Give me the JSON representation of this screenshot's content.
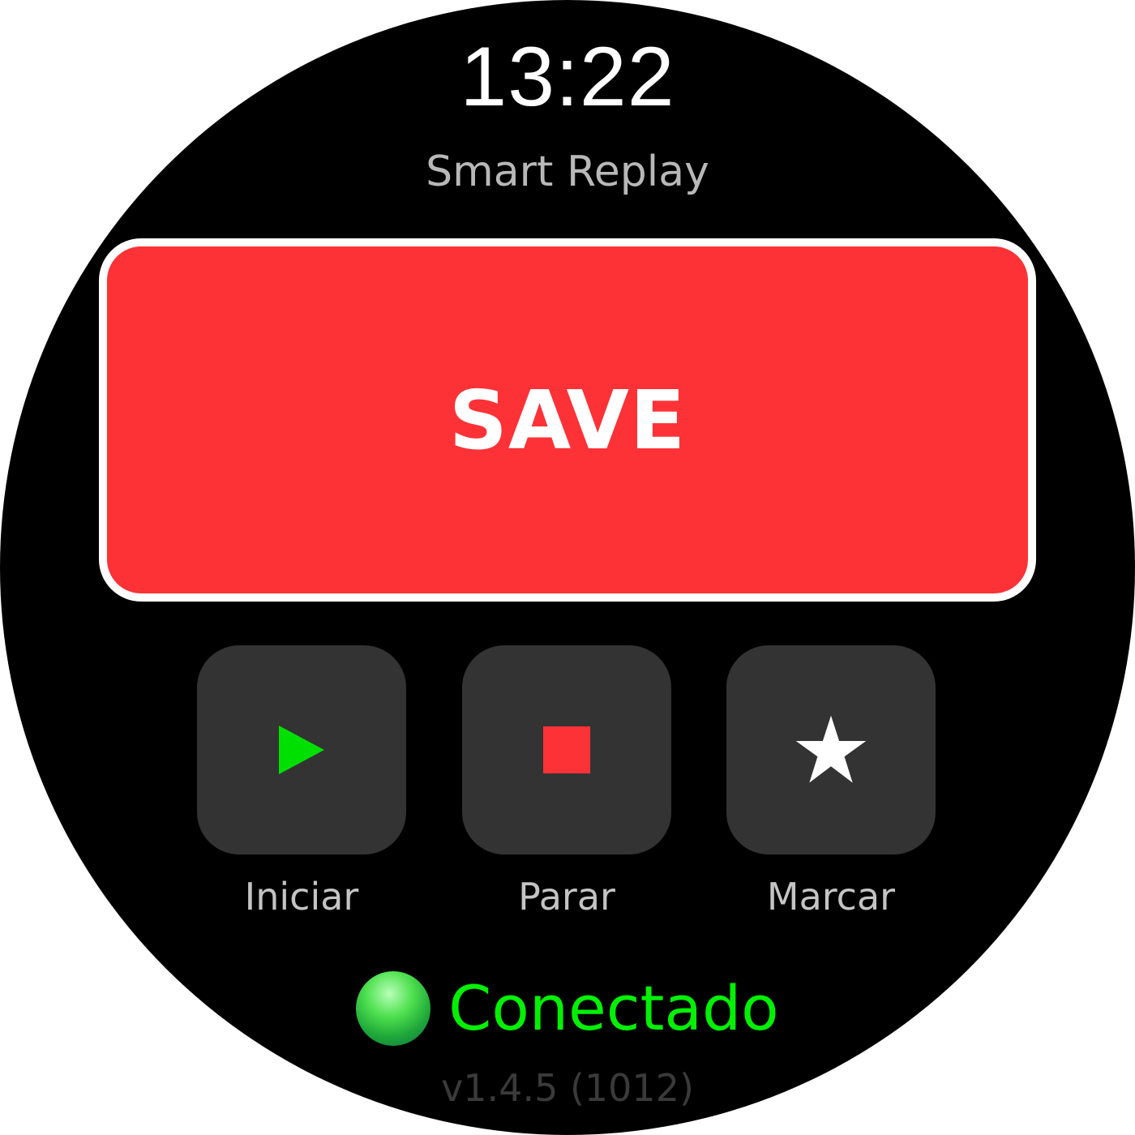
{
  "header": {
    "time": "13:22",
    "app_title": "Smart Replay"
  },
  "save_button": {
    "label": "SAVE",
    "color": "#fd3237"
  },
  "controls": [
    {
      "label": "Iniciar",
      "icon": "play-icon",
      "icon_color": "#00e000"
    },
    {
      "label": "Parar",
      "icon": "stop-icon",
      "icon_color": "#fd3237"
    },
    {
      "label": "Marcar",
      "icon": "star-icon",
      "icon_color": "#ffffff"
    }
  ],
  "status": {
    "text": "Conectado",
    "color": "#00f000",
    "indicator": "status-dot-icon"
  },
  "footer": {
    "version": "v1.4.5 (1012)"
  }
}
